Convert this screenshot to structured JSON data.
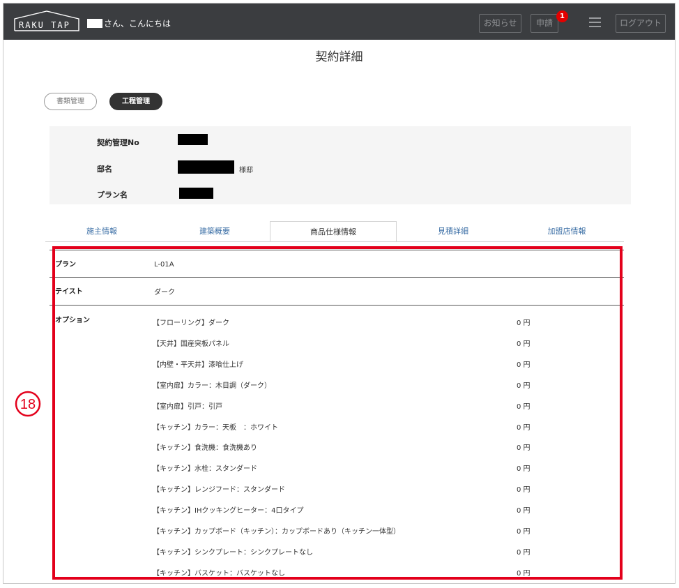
{
  "header": {
    "logo_text": "RAKU TAP",
    "greeting": "さん、こんにちは",
    "notice_label": "お知らせ",
    "apply_label": "申請",
    "apply_badge": "1",
    "menu_icon": "hamburger-menu-icon",
    "logout_label": "ログアウト"
  },
  "page": {
    "title": "契約詳細"
  },
  "toggles": {
    "documents": "書類管理",
    "process": "工程管理"
  },
  "info": {
    "contract_no_label": "契約管理No",
    "house_name_label": "邸名",
    "house_suffix": "様邸",
    "plan_name_label": "プラン名"
  },
  "tabs": [
    {
      "label": "施主情報"
    },
    {
      "label": "建築概要"
    },
    {
      "label": "商品仕様情報"
    },
    {
      "label": "見積詳細"
    },
    {
      "label": "加盟店情報"
    }
  ],
  "spec": {
    "plan_label": "プラン",
    "plan_value": "L-01A",
    "taste_label": "テイスト",
    "taste_value": "ダーク",
    "options_label": "オプション",
    "options": [
      {
        "name": "【フローリング】ダーク",
        "price": "0 円"
      },
      {
        "name": "【天井】国産突板パネル",
        "price": "0 円"
      },
      {
        "name": "【内壁・平天井】漆喰仕上げ",
        "price": "0 円"
      },
      {
        "name": "【室内扉】カラー：木目調（ダーク）",
        "price": "0 円"
      },
      {
        "name": "【室内扉】引戸：引戸",
        "price": "0 円"
      },
      {
        "name": "【キッチン】カラー：天板　：ホワイト",
        "price": "0 円"
      },
      {
        "name": "【キッチン】食洗機：食洗機あり",
        "price": "0 円"
      },
      {
        "name": "【キッチン】水栓：スタンダード",
        "price": "0 円"
      },
      {
        "name": "【キッチン】レンジフード：スタンダード",
        "price": "0 円"
      },
      {
        "name": "【キッチン】IHクッキングヒーター：4口タイプ",
        "price": "0 円"
      },
      {
        "name": "【キッチン】カップボード（キッチン）：カップボードあり（キッチン一体型）",
        "price": "0 円"
      },
      {
        "name": "【キッチン】シンクプレート：シンクプレートなし",
        "price": "0 円"
      },
      {
        "name": "【キッチン】バスケット：バスケットなし",
        "price": "0 円"
      }
    ]
  },
  "annotation": {
    "number": "18",
    "color": "#e3001b"
  }
}
